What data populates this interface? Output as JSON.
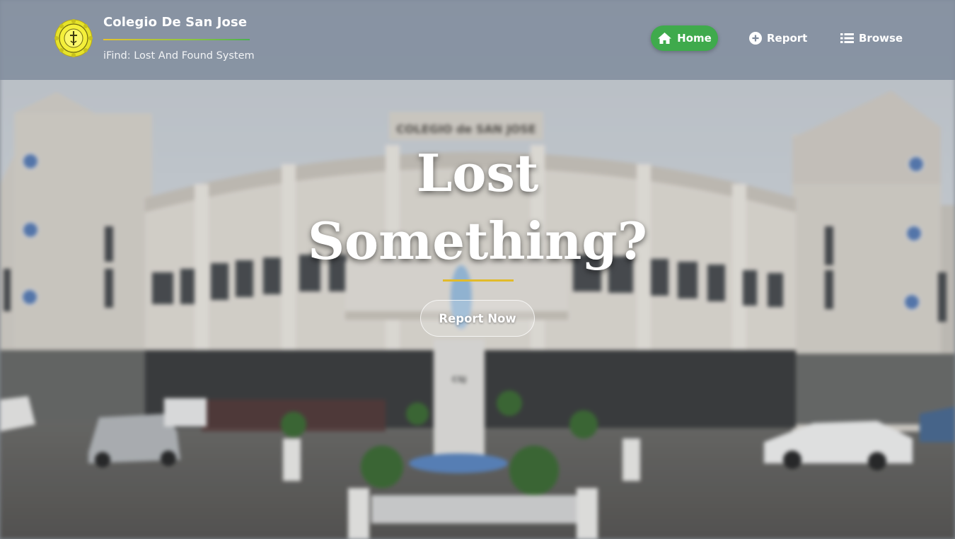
{
  "brand": {
    "title": "Colegio De San Jose",
    "subtitle": "iFind: Lost And Found System",
    "logo_icon": "school-seal-icon"
  },
  "nav": {
    "items": [
      {
        "label": "Home",
        "icon": "home-icon",
        "active": true
      },
      {
        "label": "Report",
        "icon": "plus-circle-icon",
        "active": false
      },
      {
        "label": "Browse",
        "icon": "list-icon",
        "active": false
      }
    ]
  },
  "hero": {
    "title_line1": "Lost",
    "title_line2": "Something?",
    "cta_label": "Report Now",
    "building_sign": "COLEGIO de SAN JOSE",
    "statue_sign": "CSJ"
  },
  "colors": {
    "accent_green": "#3faa4c",
    "accent_gold": "#e2bb2a",
    "header_bg": "#7e8a9b"
  }
}
